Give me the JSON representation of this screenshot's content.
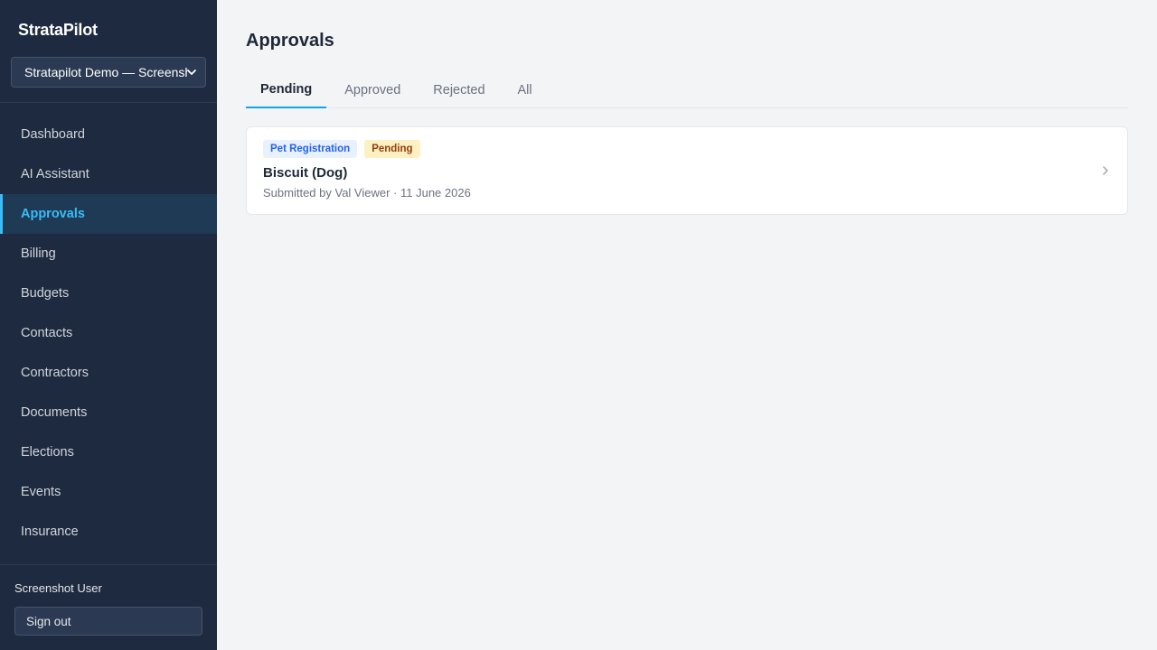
{
  "app": {
    "brand": "StrataPilot",
    "org_selector": {
      "selected": "Stratapilot Demo — Screenshot"
    }
  },
  "sidebar": {
    "items": [
      {
        "label": "Dashboard",
        "active": false
      },
      {
        "label": "AI Assistant",
        "active": false
      },
      {
        "label": "Approvals",
        "active": true
      },
      {
        "label": "Billing",
        "active": false
      },
      {
        "label": "Budgets",
        "active": false
      },
      {
        "label": "Contacts",
        "active": false
      },
      {
        "label": "Contractors",
        "active": false
      },
      {
        "label": "Documents",
        "active": false
      },
      {
        "label": "Elections",
        "active": false
      },
      {
        "label": "Events",
        "active": false
      },
      {
        "label": "Insurance",
        "active": false
      }
    ],
    "user_name": "Screenshot User",
    "sign_out_label": "Sign out"
  },
  "main": {
    "title": "Approvals",
    "tabs": [
      {
        "label": "Pending",
        "active": true
      },
      {
        "label": "Approved",
        "active": false
      },
      {
        "label": "Rejected",
        "active": false
      },
      {
        "label": "All",
        "active": false
      }
    ],
    "approvals": [
      {
        "type_badge": "Pet Registration",
        "status_badge": "Pending",
        "title": "Biscuit (Dog)",
        "meta": "Submitted by Val Viewer · 11 June 2026"
      }
    ]
  },
  "colors": {
    "sidebar_bg": "#1e2a3f",
    "accent": "#38bdf8",
    "tab_underline": "#0ea5e9",
    "type_badge_bg": "#e8f1fd",
    "type_badge_text": "#2563eb",
    "status_badge_bg": "#fdf0c3",
    "status_badge_text": "#92400e"
  },
  "icons": {
    "org_selector": "chevron-down-icon",
    "card": "chevron-right-icon"
  }
}
